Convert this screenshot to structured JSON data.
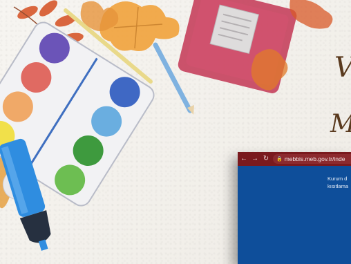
{
  "browser": {
    "back_icon": "arrow-left-icon",
    "forward_icon": "arrow-right-icon",
    "reload_icon": "reload-icon",
    "lock_icon": "lock-icon",
    "url": "mebbis.meb.gov.tr/inde",
    "content_line1": "Kurum d",
    "content_line2": "kısıtlama"
  },
  "headline": {
    "line1": "V",
    "line2": "M"
  },
  "colors": {
    "browser_bar": "#7a1a1e",
    "page_bg": "#0e4e9a",
    "script_text": "#5a3a1e"
  }
}
